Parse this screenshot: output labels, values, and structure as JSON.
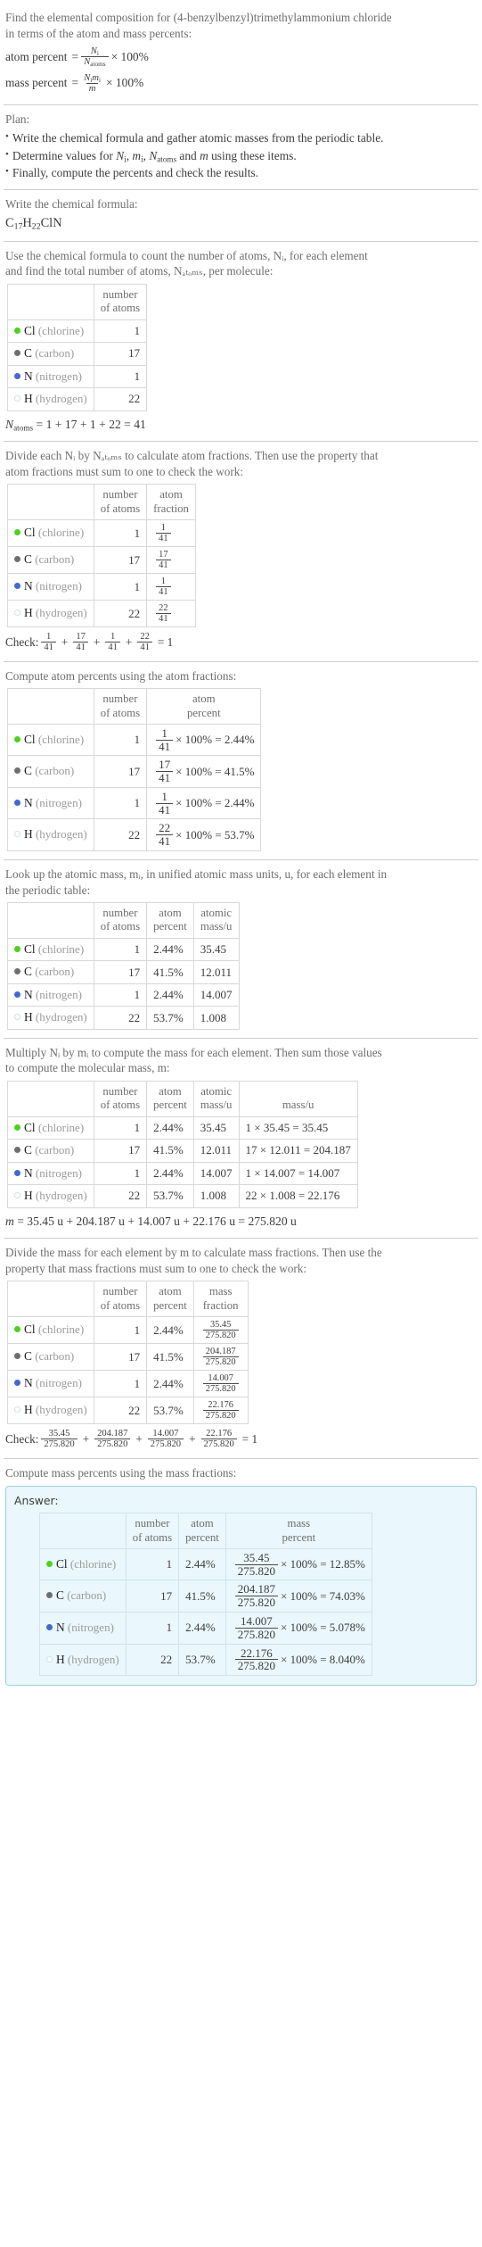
{
  "header": {
    "line1": "Find the elemental composition for (4-benzylbenzyl)trimethylammonium chloride",
    "line2": "in terms of the atom and mass percents:",
    "atom_percent_label": "atom percent",
    "mass_percent_label": "mass percent",
    "eq_equals": "=",
    "times_100": "× 100%",
    "atom_num": "N",
    "atom_num_sub": "i",
    "atom_den": "N",
    "atom_den_sub": "atoms",
    "mass_num": "N",
    "mass_num_sub": "i",
    "mass_num2": "m",
    "mass_num2_sub": "i",
    "mass_den": "m"
  },
  "plan": {
    "title": "Plan:",
    "bullet_glyph": "•",
    "items": [
      "Write the chemical formula and gather atomic masses from the periodic table.",
      "Determine values for Nᵢ, mᵢ, Nₐₜₒₘₛ and m using these items.",
      "Finally, compute the percents and check the results."
    ],
    "item2_parts": {
      "pre": "Determine values for ",
      "v1": "N",
      "v1sub": "i",
      "sep1": ", ",
      "v2": "m",
      "v2sub": "i",
      "sep2": ", ",
      "v3": "N",
      "v3sub": "atoms",
      "mid": " and ",
      "v4": "m",
      "post": " using these items."
    }
  },
  "formula_section": {
    "prompt": "Write the chemical formula:",
    "formula_parts": [
      {
        "sym": "C",
        "sub": "17"
      },
      {
        "sym": "H",
        "sub": "22"
      },
      {
        "sym": "Cl",
        "sub": ""
      },
      {
        "sym": "N",
        "sub": ""
      }
    ]
  },
  "count_section": {
    "prompt_line1": "Use the chemical formula to count the number of atoms, Nᵢ, for each element",
    "prompt_line2": "and find the total number of atoms, Nₐₜₒₘₛ, per molecule:",
    "headers": [
      "",
      "number\nof atoms"
    ],
    "header_col2_l1": "number",
    "header_col2_l2": "of atoms",
    "rows": [
      {
        "sym": "Cl",
        "name": "(chlorine)",
        "color": "#4cd21e",
        "hollow": false,
        "count": "1"
      },
      {
        "sym": "C",
        "name": "(carbon)",
        "color": "#6e6e6e",
        "hollow": false,
        "count": "17"
      },
      {
        "sym": "N",
        "name": "(nitrogen)",
        "color": "#4169d0",
        "hollow": false,
        "count": "1"
      },
      {
        "sym": "H",
        "name": "(hydrogen)",
        "color": "#ffffff",
        "hollow": true,
        "count": "22"
      }
    ],
    "total_line": "Nₐₜₒₘₛ = 1 + 17 + 1 + 22 = 41",
    "total_prefix_sym": "N",
    "total_prefix_sub": "atoms",
    "total_expr": "= 1 + 17 + 1 + 22 = 41"
  },
  "fraction_section": {
    "prompt_line1": "Divide each Nᵢ by Nₐₜₒₘₛ to calculate atom fractions. Then use the property that",
    "prompt_line2": "atom fractions must sum to one to check the work:",
    "header_col2_l1": "number",
    "header_col2_l2": "of atoms",
    "header_col3_l1": "atom",
    "header_col3_l2": "fraction",
    "rows": [
      {
        "sym": "Cl",
        "name": "(chlorine)",
        "color": "#4cd21e",
        "hollow": false,
        "count": "1",
        "num": "1",
        "den": "41"
      },
      {
        "sym": "C",
        "name": "(carbon)",
        "color": "#6e6e6e",
        "hollow": false,
        "count": "17",
        "num": "17",
        "den": "41"
      },
      {
        "sym": "N",
        "name": "(nitrogen)",
        "color": "#4169d0",
        "hollow": false,
        "count": "1",
        "num": "1",
        "den": "41"
      },
      {
        "sym": "H",
        "name": "(hydrogen)",
        "color": "#ffffff",
        "hollow": true,
        "count": "22",
        "num": "22",
        "den": "41"
      }
    ],
    "check_label": "Check:",
    "check_terms": [
      {
        "num": "1",
        "den": "41"
      },
      {
        "num": "17",
        "den": "41"
      },
      {
        "num": "1",
        "den": "41"
      },
      {
        "num": "22",
        "den": "41"
      }
    ],
    "check_plus": "+",
    "check_equals": "= 1"
  },
  "atom_percent_section": {
    "prompt": "Compute atom percents using the atom fractions:",
    "header_col2_l1": "number",
    "header_col2_l2": "of atoms",
    "header_col3_l1": "atom",
    "header_col3_l2": "percent",
    "times100": "× 100% =",
    "rows": [
      {
        "sym": "Cl",
        "name": "(chlorine)",
        "color": "#4cd21e",
        "hollow": false,
        "count": "1",
        "num": "1",
        "den": "41",
        "result": "2.44%"
      },
      {
        "sym": "C",
        "name": "(carbon)",
        "color": "#6e6e6e",
        "hollow": false,
        "count": "17",
        "num": "17",
        "den": "41",
        "result": "41.5%"
      },
      {
        "sym": "N",
        "name": "(nitrogen)",
        "color": "#4169d0",
        "hollow": false,
        "count": "1",
        "num": "1",
        "den": "41",
        "result": "2.44%"
      },
      {
        "sym": "H",
        "name": "(hydrogen)",
        "color": "#ffffff",
        "hollow": true,
        "count": "22",
        "num": "22",
        "den": "41",
        "result": "53.7%"
      }
    ]
  },
  "atomic_mass_section": {
    "prompt_line1": "Look up the atomic mass, mᵢ, in unified atomic mass units, u, for each element in",
    "prompt_line2": "the periodic table:",
    "header_col2_l1": "number",
    "header_col2_l2": "of atoms",
    "header_col3_l1": "atom",
    "header_col3_l2": "percent",
    "header_col4_l1": "atomic",
    "header_col4_l2": "mass/u",
    "rows": [
      {
        "sym": "Cl",
        "name": "(chlorine)",
        "color": "#4cd21e",
        "hollow": false,
        "count": "1",
        "pct": "2.44%",
        "mass": "35.45"
      },
      {
        "sym": "C",
        "name": "(carbon)",
        "color": "#6e6e6e",
        "hollow": false,
        "count": "17",
        "pct": "41.5%",
        "mass": "12.011"
      },
      {
        "sym": "N",
        "name": "(nitrogen)",
        "color": "#4169d0",
        "hollow": false,
        "count": "1",
        "pct": "2.44%",
        "mass": "14.007"
      },
      {
        "sym": "H",
        "name": "(hydrogen)",
        "color": "#ffffff",
        "hollow": true,
        "count": "22",
        "pct": "53.7%",
        "mass": "1.008"
      }
    ]
  },
  "mass_section": {
    "prompt_line1": "Multiply Nᵢ by mᵢ to compute the mass for each element. Then sum those values",
    "prompt_line2": "to compute the molecular mass, m:",
    "header_col2_l1": "number",
    "header_col2_l2": "of atoms",
    "header_col3_l1": "atom",
    "header_col3_l2": "percent",
    "header_col4_l1": "atomic",
    "header_col4_l2": "mass/u",
    "header_col5_l1": "",
    "header_col5_l2": "mass/u",
    "rows": [
      {
        "sym": "Cl",
        "name": "(chlorine)",
        "color": "#4cd21e",
        "hollow": false,
        "count": "1",
        "pct": "2.44%",
        "mass": "35.45",
        "product": "1 × 35.45 = 35.45"
      },
      {
        "sym": "C",
        "name": "(carbon)",
        "color": "#6e6e6e",
        "hollow": false,
        "count": "17",
        "pct": "41.5%",
        "mass": "12.011",
        "product": "17 × 12.011 = 204.187"
      },
      {
        "sym": "N",
        "name": "(nitrogen)",
        "color": "#4169d0",
        "hollow": false,
        "count": "1",
        "pct": "2.44%",
        "mass": "14.007",
        "product": "1 × 14.007 = 14.007"
      },
      {
        "sym": "H",
        "name": "(hydrogen)",
        "color": "#ffffff",
        "hollow": true,
        "count": "22",
        "pct": "53.7%",
        "mass": "1.008",
        "product": "22 × 1.008 = 22.176"
      }
    ],
    "sum_line_sym": "m",
    "sum_line": "= 35.45 u + 204.187 u + 14.007 u + 22.176 u = 275.820 u"
  },
  "mass_fraction_section": {
    "prompt_line1": "Divide the mass for each element by m to calculate mass fractions. Then use the",
    "prompt_line2": "property that mass fractions must sum to one to check the work:",
    "header_col2_l1": "number",
    "header_col2_l2": "of atoms",
    "header_col3_l1": "atom",
    "header_col3_l2": "percent",
    "header_col4_l1": "mass",
    "header_col4_l2": "fraction",
    "rows": [
      {
        "sym": "Cl",
        "name": "(chlorine)",
        "color": "#4cd21e",
        "hollow": false,
        "count": "1",
        "pct": "2.44%",
        "num": "35.45",
        "den": "275.820"
      },
      {
        "sym": "C",
        "name": "(carbon)",
        "color": "#6e6e6e",
        "hollow": false,
        "count": "17",
        "pct": "41.5%",
        "num": "204.187",
        "den": "275.820"
      },
      {
        "sym": "N",
        "name": "(nitrogen)",
        "color": "#4169d0",
        "hollow": false,
        "count": "1",
        "pct": "2.44%",
        "num": "14.007",
        "den": "275.820"
      },
      {
        "sym": "H",
        "name": "(hydrogen)",
        "color": "#ffffff",
        "hollow": true,
        "count": "22",
        "pct": "53.7%",
        "num": "22.176",
        "den": "275.820"
      }
    ],
    "check_label": "Check:",
    "check_terms": [
      {
        "num": "35.45",
        "den": "275.820"
      },
      {
        "num": "204.187",
        "den": "275.820"
      },
      {
        "num": "14.007",
        "den": "275.820"
      },
      {
        "num": "22.176",
        "den": "275.820"
      }
    ],
    "check_plus": "+",
    "check_equals": "= 1"
  },
  "answer_section": {
    "prompt": "Compute mass percents using the mass fractions:",
    "answer_label": "Answer:",
    "header_col2_l1": "number",
    "header_col2_l2": "of atoms",
    "header_col3_l1": "atom",
    "header_col3_l2": "percent",
    "header_col4_l1": "mass",
    "header_col4_l2": "percent",
    "times100": "× 100% =",
    "rows": [
      {
        "sym": "Cl",
        "name": "(chlorine)",
        "color": "#4cd21e",
        "hollow": false,
        "count": "1",
        "pct": "2.44%",
        "num": "35.45",
        "den": "275.820",
        "result": "12.85%"
      },
      {
        "sym": "C",
        "name": "(carbon)",
        "color": "#6e6e6e",
        "hollow": false,
        "count": "17",
        "pct": "41.5%",
        "num": "204.187",
        "den": "275.820",
        "result": "74.03%"
      },
      {
        "sym": "N",
        "name": "(nitrogen)",
        "color": "#4169d0",
        "hollow": false,
        "count": "1",
        "pct": "2.44%",
        "num": "14.007",
        "den": "275.820",
        "result": "5.078%"
      },
      {
        "sym": "H",
        "name": "(hydrogen)",
        "color": "#ffffff",
        "hollow": true,
        "count": "22",
        "pct": "53.7%",
        "num": "22.176",
        "den": "275.820",
        "result": "8.040%"
      }
    ]
  },
  "colors": {
    "chlorine": "#4cd21e",
    "carbon": "#6e6e6e",
    "nitrogen": "#4169d0",
    "hydrogen": "#ffffff",
    "answer_bg": "#eaf7fc",
    "answer_border": "#9ecfe0",
    "rule": "#cfcfcf"
  }
}
